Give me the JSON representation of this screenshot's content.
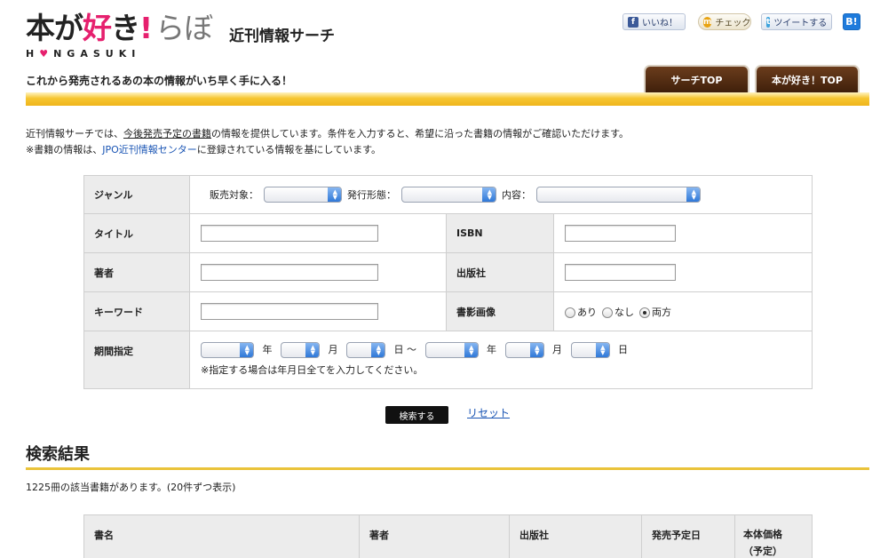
{
  "header": {
    "logo_part1": "本が",
    "logo_part2": "好",
    "logo_part3": "き",
    "logo_excl": "!",
    "logo_part4": "らぼ",
    "logo_sub_h": "H",
    "logo_sub_heart": "♥",
    "logo_sub_rest": "NGASUKI",
    "site_name": "近刊情報サーチ",
    "tagline": "これから発売されるあの本の情報がいち早く手に入る！",
    "tabs": [
      {
        "label": "サーチTOP"
      },
      {
        "label": "本が好き！TOP"
      }
    ]
  },
  "social": {
    "facebook": {
      "icon": "f",
      "label": "いいね！"
    },
    "mixi": {
      "icon": "m",
      "label": "チェック"
    },
    "twitter": {
      "icon": "t",
      "label": "ツイートする"
    },
    "hatena": {
      "label": "B!"
    }
  },
  "intro": {
    "line1_a": "近刊情報サーチでは、",
    "line1_link": "今後発売予定の書籍",
    "line1_b": "の情報を提供しています。条件を入力すると、希望に沿った書籍の情報がご確認いただけます。",
    "line2_a": "※書籍の情報は、",
    "line2_link": "JPO近刊情報センター",
    "line2_b": "に登録されている情報を基にしています。"
  },
  "form": {
    "genre_label": "ジャンル",
    "genre_target": "販売対象：",
    "genre_format": "発行形態：",
    "genre_content": "内容：",
    "title_label": "タイトル",
    "isbn_label": "ISBN",
    "author_label": "著者",
    "publisher_label": "出版社",
    "keyword_label": "キーワード",
    "image_label": "書影画像",
    "image_options": [
      "あり",
      "なし",
      "両方"
    ],
    "period_label": "期間指定",
    "year": "年",
    "month": "月",
    "day_from": "日 ～",
    "day": "日",
    "period_note": "※指定する場合は年月日全てを入力してください。",
    "search_button": "検索する",
    "reset_link": "リセット"
  },
  "results": {
    "title": "検索結果",
    "count_text": "1225冊の該当書籍があります。(20件ずつ表示)",
    "columns": [
      "書名",
      "著者",
      "出版社",
      "発売予定日",
      "本体価格"
    ],
    "last_col_sub": "（予定）"
  },
  "colors": {
    "accent_pink": "#e6206e",
    "tab_brown": "#4e2910",
    "header_bar_yellow": "#f2bd28",
    "link_blue": "#1a55b4"
  }
}
